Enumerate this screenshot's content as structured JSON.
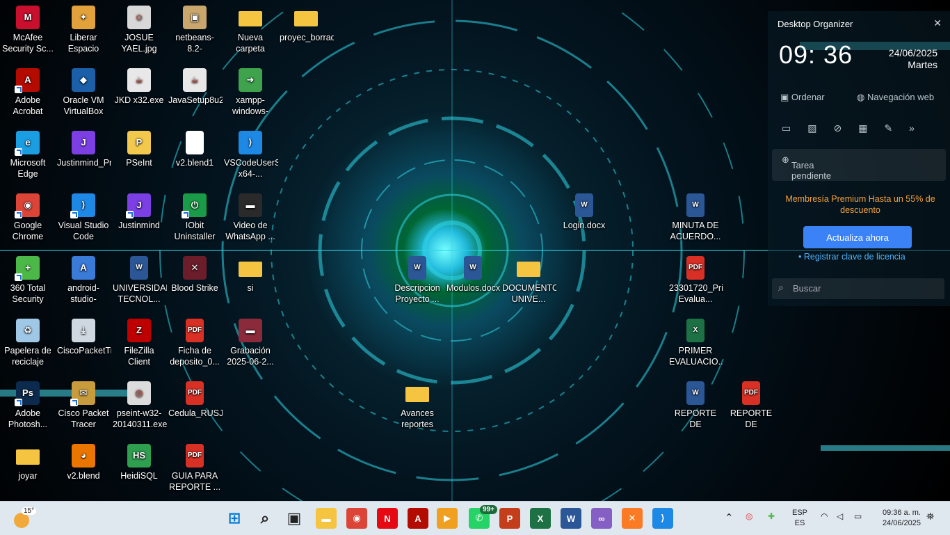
{
  "desktop": {
    "icons": [
      {
        "label": "McAfee Security Sc...",
        "icon": "mcafee-icon",
        "color": "#c8102e",
        "glyph": "M"
      },
      {
        "label": "Liberar Espacio",
        "icon": "broom-icon",
        "color": "#e2a13a",
        "glyph": "✦"
      },
      {
        "label": "JOSUE YAEL.jpg",
        "icon": "photo-icon",
        "color": "#d8d8d8",
        "glyph": "☺"
      },
      {
        "label": "netbeans-8.2-installer.exe",
        "icon": "installer-box-icon",
        "color": "#c9a66b",
        "glyph": "▣"
      },
      {
        "label": "Nueva carpeta",
        "icon": "folder-icon",
        "color": "#f5c542",
        "glyph": ""
      },
      {
        "label": "proyec_borrador",
        "icon": "folder-icon",
        "color": "#f5c542",
        "glyph": ""
      },
      {
        "label": "Adobe Acrobat",
        "icon": "acrobat-icon",
        "color": "#b30b00",
        "glyph": "A"
      },
      {
        "label": "Oracle VM VirtualBox",
        "icon": "virtualbox-icon",
        "color": "#1b5fa8",
        "glyph": "◆"
      },
      {
        "label": "JKD x32.exe",
        "icon": "java-icon",
        "color": "#e8e8e8",
        "glyph": "☕"
      },
      {
        "label": "JavaSetup8u201.exe",
        "icon": "java-icon",
        "color": "#e8e8e8",
        "glyph": "☕"
      },
      {
        "label": "xampp-windows-x64-8....",
        "icon": "installer-arrow-icon",
        "color": "#3fa34d",
        "glyph": "➜"
      },
      {
        "label": "Microsoft Edge",
        "icon": "edge-icon",
        "color": "#1b9de2",
        "glyph": "e"
      },
      {
        "label": "Justinmind_Prototyper_W...",
        "icon": "justinmind-installer-icon",
        "color": "#7b3fe4",
        "glyph": "J"
      },
      {
        "label": "PSeInt",
        "icon": "pseint-icon",
        "color": "#f2c94c",
        "glyph": "P"
      },
      {
        "label": "v2.blend1",
        "icon": "blank-file-icon",
        "color": "#ffffff",
        "glyph": ""
      },
      {
        "label": "VSCodeUserSetup-x64-...",
        "icon": "vscode-icon",
        "color": "#1e88e5",
        "glyph": "⟩"
      },
      {
        "label": "Google Chrome",
        "icon": "chrome-icon",
        "color": "#db4437",
        "glyph": "◉"
      },
      {
        "label": "Visual Studio Code",
        "icon": "vscode-icon",
        "color": "#1e88e5",
        "glyph": "⟩"
      },
      {
        "label": "Justinmind",
        "icon": "justinmind-icon",
        "color": "#7b3fe4",
        "glyph": "J"
      },
      {
        "label": "IObit Uninstaller",
        "icon": "iobit-icon",
        "color": "#1a9b47",
        "glyph": "⏻"
      },
      {
        "label": "Video de WhatsApp ...",
        "icon": "video-icon",
        "color": "#2a2a2a",
        "glyph": "▬"
      },
      {
        "label": "360 Total Security",
        "icon": "360-security-icon",
        "color": "#4cb848",
        "glyph": "+"
      },
      {
        "label": "android-studio-2024.1.2....",
        "icon": "android-studio-icon",
        "color": "#3b7bd8",
        "glyph": "A"
      },
      {
        "label": "UNIVERSIDAD TECNOL...",
        "icon": "word-document-icon",
        "color": "#2b5797",
        "glyph": "W"
      },
      {
        "label": "Blood Strike",
        "icon": "blood-strike-icon",
        "color": "#6b1d2a",
        "glyph": "✕"
      },
      {
        "label": "si",
        "icon": "folder-icon",
        "color": "#f5c542",
        "glyph": ""
      },
      {
        "label": "Papelera de reciclaje",
        "icon": "recycle-bin-icon",
        "color": "#9fc7e6",
        "glyph": "♻"
      },
      {
        "label": "CiscoPacketTracer822_6...",
        "icon": "download-icon",
        "color": "#cfd8e0",
        "glyph": "⤓"
      },
      {
        "label": "FileZilla Client",
        "icon": "filezilla-icon",
        "color": "#bf0000",
        "glyph": "Z"
      },
      {
        "label": "Ficha de deposito_0...",
        "icon": "pdf-icon",
        "color": "#d93025",
        "glyph": "PDF"
      },
      {
        "label": "Grabación 2025-06-2...",
        "icon": "video-icon",
        "color": "#8b2a3a",
        "glyph": "▬"
      },
      {
        "label": "Adobe Photosh...",
        "icon": "photoshop-icon",
        "color": "#0b2a4d",
        "glyph": "Ps"
      },
      {
        "label": "Cisco Packet Tracer",
        "icon": "cisco-packet-tracer-icon",
        "color": "#c89b3c",
        "glyph": "✉"
      },
      {
        "label": "pseint-w32-20140311.exe",
        "icon": "installer-disc-icon",
        "color": "#dcdcdc",
        "glyph": "◎"
      },
      {
        "label": "Cedula_RUSJ050824HSP...",
        "icon": "pdf-icon",
        "color": "#d93025",
        "glyph": "PDF"
      },
      {
        "label": "joyar",
        "icon": "folder-icon",
        "color": "#f5c542",
        "glyph": ""
      },
      {
        "label": "v2.blend",
        "icon": "blender-icon",
        "color": "#ea7600",
        "glyph": "◕"
      },
      {
        "label": "HeidiSQL",
        "icon": "heidisql-icon",
        "color": "#2e9e4f",
        "glyph": "HS"
      },
      {
        "label": "GUIA PARA REPORTE ...",
        "icon": "pdf-icon",
        "color": "#d93025",
        "glyph": "PDF"
      },
      {
        "label": "Login.docx",
        "icon": "word-document-icon",
        "color": "#2b5797",
        "glyph": "W"
      },
      {
        "label": "MINUTA DE ACUERDO...",
        "icon": "word-document-icon",
        "color": "#2b5797",
        "glyph": "W"
      },
      {
        "label": "Descripcion Proyecto ...",
        "icon": "word-document-icon",
        "color": "#2b5797",
        "glyph": "W"
      },
      {
        "label": "Modulos.docx.doc",
        "icon": "word-document-icon",
        "color": "#2b5797",
        "glyph": "W"
      },
      {
        "label": "DOCUMENTOS UNIVE...",
        "icon": "folder-icon",
        "color": "#f5c542",
        "glyph": ""
      },
      {
        "label": "23301720_Primer Evalua...",
        "icon": "pdf-icon",
        "color": "#d93025",
        "glyph": "PDF"
      },
      {
        "label": "PRIMER EVALUACIO...",
        "icon": "excel-icon",
        "color": "#1e7145",
        "glyph": "X"
      },
      {
        "label": "Avances reportes",
        "icon": "folder-icon",
        "color": "#f5c542",
        "glyph": ""
      },
      {
        "label": "REPORTE DE ESTADIA.d...",
        "icon": "word-document-icon",
        "color": "#2b5797",
        "glyph": "W"
      },
      {
        "label": "REPORTE DE ESTADIA_b...",
        "icon": "pdf-icon",
        "color": "#d93025",
        "glyph": "PDF"
      }
    ]
  },
  "organizer": {
    "title": "Desktop Organizer",
    "time": "09: 36",
    "date": "24/06/2025",
    "weekday": "Martes",
    "sort_label": "Ordenar",
    "web_label": "Navegación web",
    "pending_placeholder": "Tarea pendiente",
    "promo": "Membresía Premium Hasta un 55% de descuento",
    "upgrade_label": "Actualiza ahora",
    "license_label": "• Registrar clave de licencia",
    "search_placeholder": "Buscar",
    "promo_color": "#f7a23c",
    "button_color": "#3b82f6"
  },
  "taskbar": {
    "weather_temp": "15°",
    "whatsapp_badge": "99+",
    "lang_top": "ESP",
    "lang_bottom": "ES",
    "clock_time": "09:36 a. m.",
    "clock_date": "24/06/2025",
    "apps": [
      {
        "icon": "windows-start-icon",
        "color": "#0078d4",
        "glyph": "⊞"
      },
      {
        "icon": "search-icon",
        "color": "#222222",
        "glyph": "⌕"
      },
      {
        "icon": "task-view-icon",
        "color": "#222222",
        "glyph": "▣"
      },
      {
        "icon": "file-explorer-icon",
        "color": "#f5c542",
        "glyph": "▬"
      },
      {
        "icon": "chrome-icon",
        "color": "#db4437",
        "glyph": "◉"
      },
      {
        "icon": "netflix-icon",
        "color": "#e50914",
        "glyph": "N"
      },
      {
        "icon": "acrobat-icon",
        "color": "#b30b00",
        "glyph": "A"
      },
      {
        "icon": "media-player-icon",
        "color": "#f0a020",
        "glyph": "▶"
      },
      {
        "icon": "whatsapp-icon",
        "color": "#25d366",
        "glyph": "✆"
      },
      {
        "icon": "powerpoint-icon",
        "color": "#c43e1c",
        "glyph": "P"
      },
      {
        "icon": "excel-icon",
        "color": "#1e7145",
        "glyph": "X"
      },
      {
        "icon": "word-icon",
        "color": "#2b5797",
        "glyph": "W"
      },
      {
        "icon": "visual-studio-icon",
        "color": "#865fc5",
        "glyph": "∞"
      },
      {
        "icon": "xampp-icon",
        "color": "#fb7a24",
        "glyph": "✕"
      },
      {
        "icon": "vscode-icon",
        "color": "#1e88e5",
        "glyph": "⟩"
      }
    ]
  }
}
